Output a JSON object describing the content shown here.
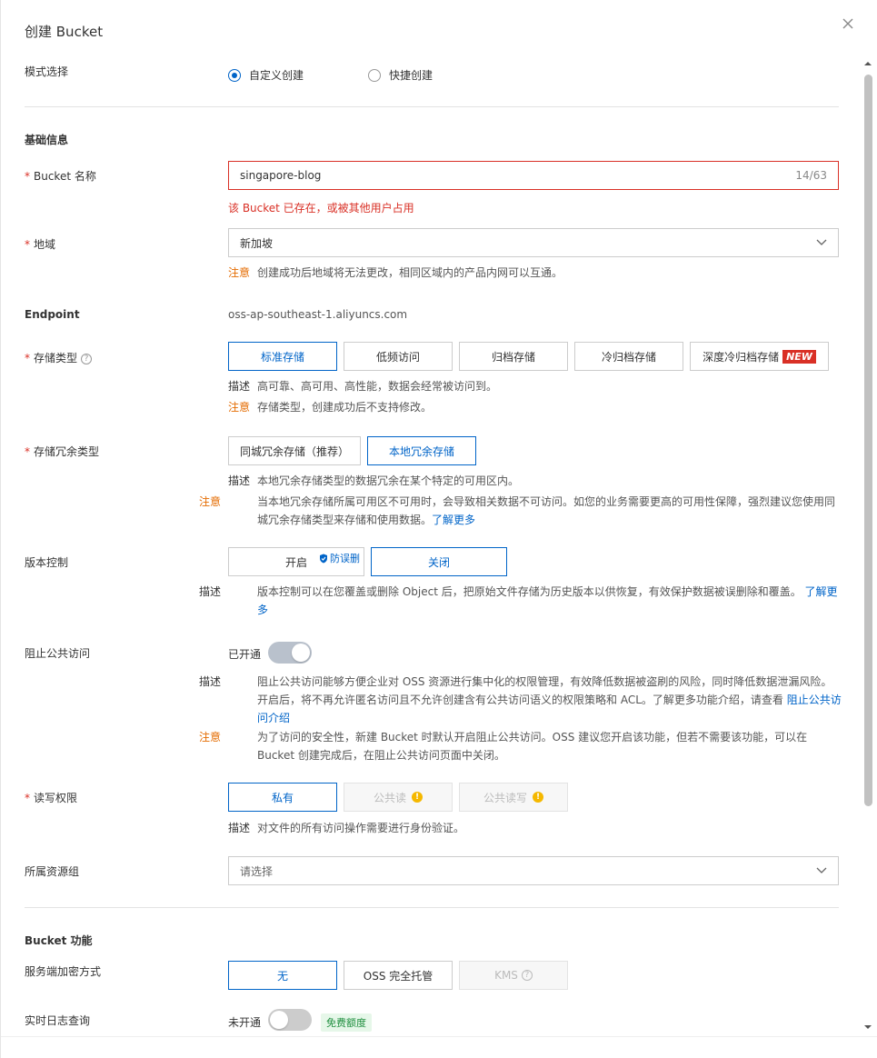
{
  "dialog": {
    "title": "创建 Bucket"
  },
  "mode": {
    "label": "模式选择",
    "options": [
      {
        "label": "自定义创建",
        "selected": true
      },
      {
        "label": "快捷创建",
        "selected": false
      }
    ]
  },
  "basic": {
    "section_title": "基础信息",
    "bucket_name": {
      "label": "Bucket 名称",
      "value": "singapore-blog",
      "count": "14/63",
      "error": "该 Bucket 已存在，或被其他用户占用"
    },
    "region": {
      "label": "地域",
      "value": "新加坡",
      "note_tag": "注意",
      "note": "创建成功后地域将无法更改，相同区域内的产品内网可以互通。"
    },
    "endpoint": {
      "label": "Endpoint",
      "value": "oss-ap-southeast-1.aliyuncs.com"
    },
    "storage_class": {
      "label": "存储类型",
      "options": [
        "标准存储",
        "低频访问",
        "归档存储",
        "冷归档存储",
        "深度冷归档存储"
      ],
      "new_badge": "NEW",
      "desc_tag": "描述",
      "desc": "高可靠、高可用、高性能，数据会经常被访问到。",
      "note_tag": "注意",
      "note": "存储类型，创建成功后不支持修改。"
    },
    "redundancy": {
      "label": "存储冗余类型",
      "options": [
        "同城冗余存储（推荐）",
        "本地冗余存储"
      ],
      "desc_tag": "描述",
      "desc": "本地冗余存储类型的数据冗余在某个特定的可用区内。",
      "note_tag": "注意",
      "note": "当本地冗余存储所属可用区不可用时，会导致相关数据不可访问。如您的业务需要更高的可用性保障，强烈建议您使用同城冗余存储类型来存储和使用数据。",
      "link": "了解更多"
    },
    "versioning": {
      "label": "版本控制",
      "on_label": "开启",
      "shield_label": "防误删",
      "off_label": "关闭",
      "desc_tag": "描述",
      "desc": "版本控制可以在您覆盖或删除 Object 后，把原始文件存储为历史版本以供恢复，有效保护数据被误删除和覆盖。",
      "link": "了解更多"
    },
    "block_public": {
      "label": "阻止公共访问",
      "state": "已开通",
      "desc_tag": "描述",
      "desc": "阻止公共访问能够方便企业对 OSS 资源进行集中化的权限管理，有效降低数据被盗刷的风险，同时降低数据泄漏风险。开启后，将不再允许匿名访问且不允许创建含有公共访问语义的权限策略和 ACL。了解更多功能介绍，请查看",
      "link": "阻止公共访问介绍",
      "note_tag": "注意",
      "note": "为了访问的安全性，新建 Bucket 时默认开启阻止公共访问。OSS 建议您开启该功能，但若不需要该功能，可以在 Bucket 创建完成后，在阻止公共访问页面中关闭。"
    },
    "acl": {
      "label": "读写权限",
      "options": [
        "私有",
        "公共读",
        "公共读写"
      ],
      "desc_tag": "描述",
      "desc": "对文件的所有访问操作需要进行身份验证。"
    },
    "resource_group": {
      "label": "所属资源组",
      "placeholder": "请选择"
    }
  },
  "features": {
    "section_title": "Bucket 功能",
    "encryption": {
      "label": "服务端加密方式",
      "options": [
        "无",
        "OSS 完全托管",
        "KMS"
      ]
    },
    "realtime_log": {
      "label": "实时日志查询",
      "state": "未开通",
      "badge": "免费额度"
    }
  }
}
